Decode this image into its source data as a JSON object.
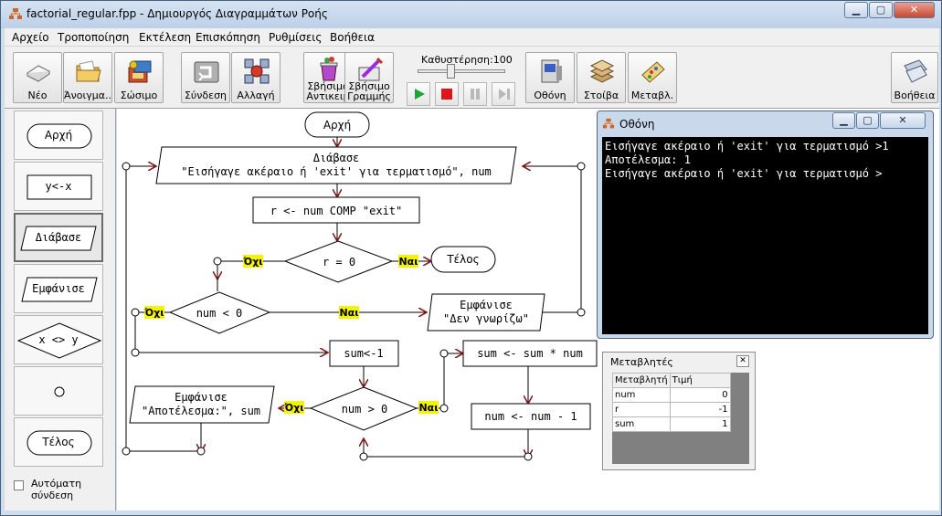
{
  "window": {
    "title": "factorial_regular.fpp - Δημιουργός Διαγραμμάτων Ροής"
  },
  "menu": [
    "Αρχείο",
    "Τροποποίηση",
    "Εκτέλεση",
    "Επισκόπηση",
    "Ρυθμίσεις",
    "Βοήθεια"
  ],
  "toolbar": {
    "new": "Νέο",
    "open": "Άνοιγμα..",
    "save": "Σώσιμο",
    "connect": "Σύνδεση",
    "change": "Αλλαγή",
    "delete_obj": [
      "Σβήσιμο",
      "Αντικειμ"
    ],
    "delete_line": [
      "Σβήσιμο",
      "Γραμμής"
    ],
    "delay_label": "Καθυστέρηση:100",
    "delay_value": 100,
    "screen": "Οθόνη",
    "stack": "Στοίβα",
    "vars": "Μεταβλ.",
    "help": "Βοήθεια"
  },
  "palette": {
    "start": "Αρχή",
    "assign": "y<-x",
    "read": "Διάβασε",
    "print": "Εμφάνισε",
    "decision": "x <> y",
    "end": "Τέλος",
    "auto_connect": "Αυτόματη σύνδεση"
  },
  "flow": {
    "start": "Αρχή",
    "read_1": "Διάβασε",
    "read_2": "\"Εισήγαγε ακέραιο ή 'exit' για τερματισμό\", num",
    "assign_r": "r <- num COMP \"exit\"",
    "dec_r": "r = 0",
    "end": "Τέλος",
    "dec_neg": "num < 0",
    "print_unknown_1": "Εμφάνισε",
    "print_unknown_2": "\"Δεν γνωρίζω\"",
    "sum_init": "sum<-1",
    "sum_mul": "sum <- sum * num",
    "num_dec": "num <- num - 1",
    "dec_pos": "num > 0",
    "print_res_1": "Εμφάνισε",
    "print_res_2": "\"Αποτέλεσμα:\", sum",
    "yes": "Ναι",
    "no": "Όχι"
  },
  "screen_window": {
    "title": "Οθόνη",
    "lines": [
      "Εισήγαγε ακέραιο ή 'exit' για τερματισμό >1",
      "Αποτέλεσμα: 1",
      "Εισήγαγε ακέραιο ή 'exit' για τερματισμό >"
    ]
  },
  "vars_window": {
    "title": "Μεταβλητές",
    "headers": [
      "Μεταβλητή",
      "Τιμή"
    ],
    "rows": [
      {
        "name": "num",
        "value": "0"
      },
      {
        "name": "r",
        "value": "-1"
      },
      {
        "name": "sum",
        "value": "1"
      }
    ]
  },
  "colors": {
    "arrow": "#8b1a1a",
    "label_bg": "#f3f200",
    "console_bg": "#000000"
  }
}
